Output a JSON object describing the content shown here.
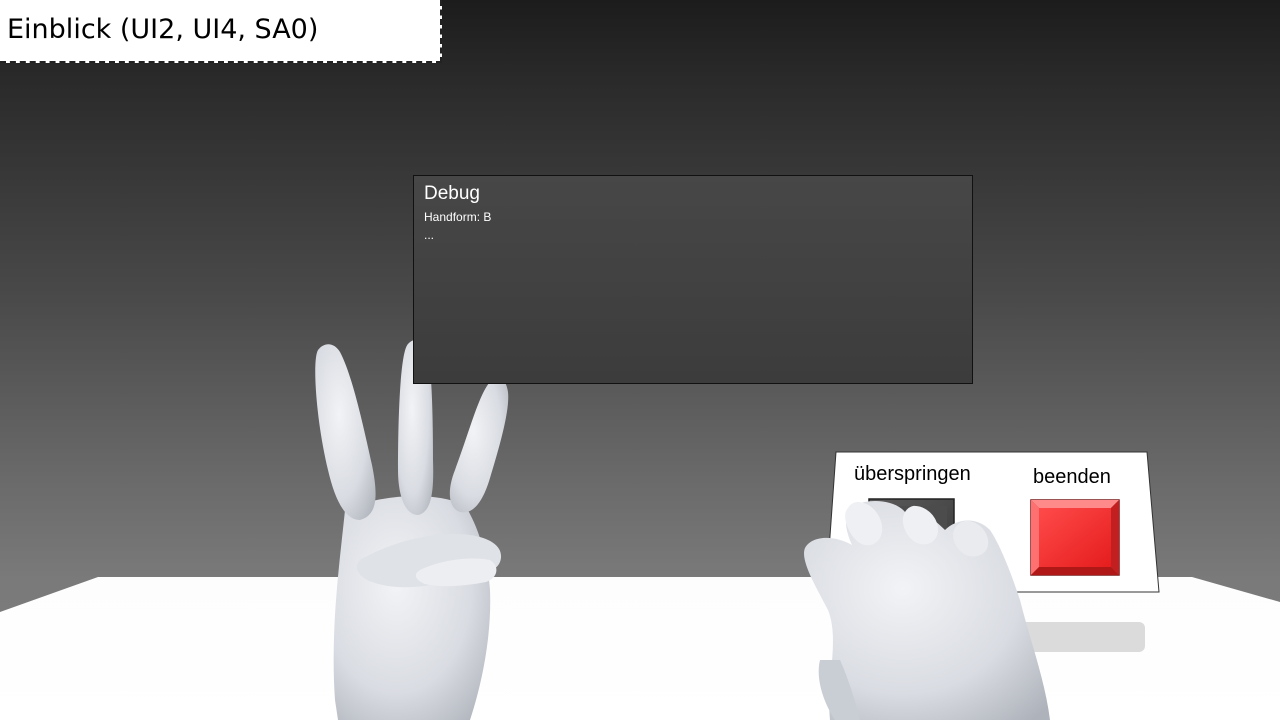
{
  "title_overlay": {
    "text": "Einblick (UI2, UI4, SA0)"
  },
  "debug_panel": {
    "title": "Debug",
    "lines": [
      "Handform: B",
      "..."
    ]
  },
  "button_panel": {
    "skip_label": "überspringen",
    "end_label": "beenden",
    "skip_color": "#4a4a4a",
    "end_color": "#ff2b2b"
  },
  "scene": {
    "wall_color": "#5a5a5a",
    "table_color": "#ffffff",
    "hand_color": "#e6e8ec"
  }
}
